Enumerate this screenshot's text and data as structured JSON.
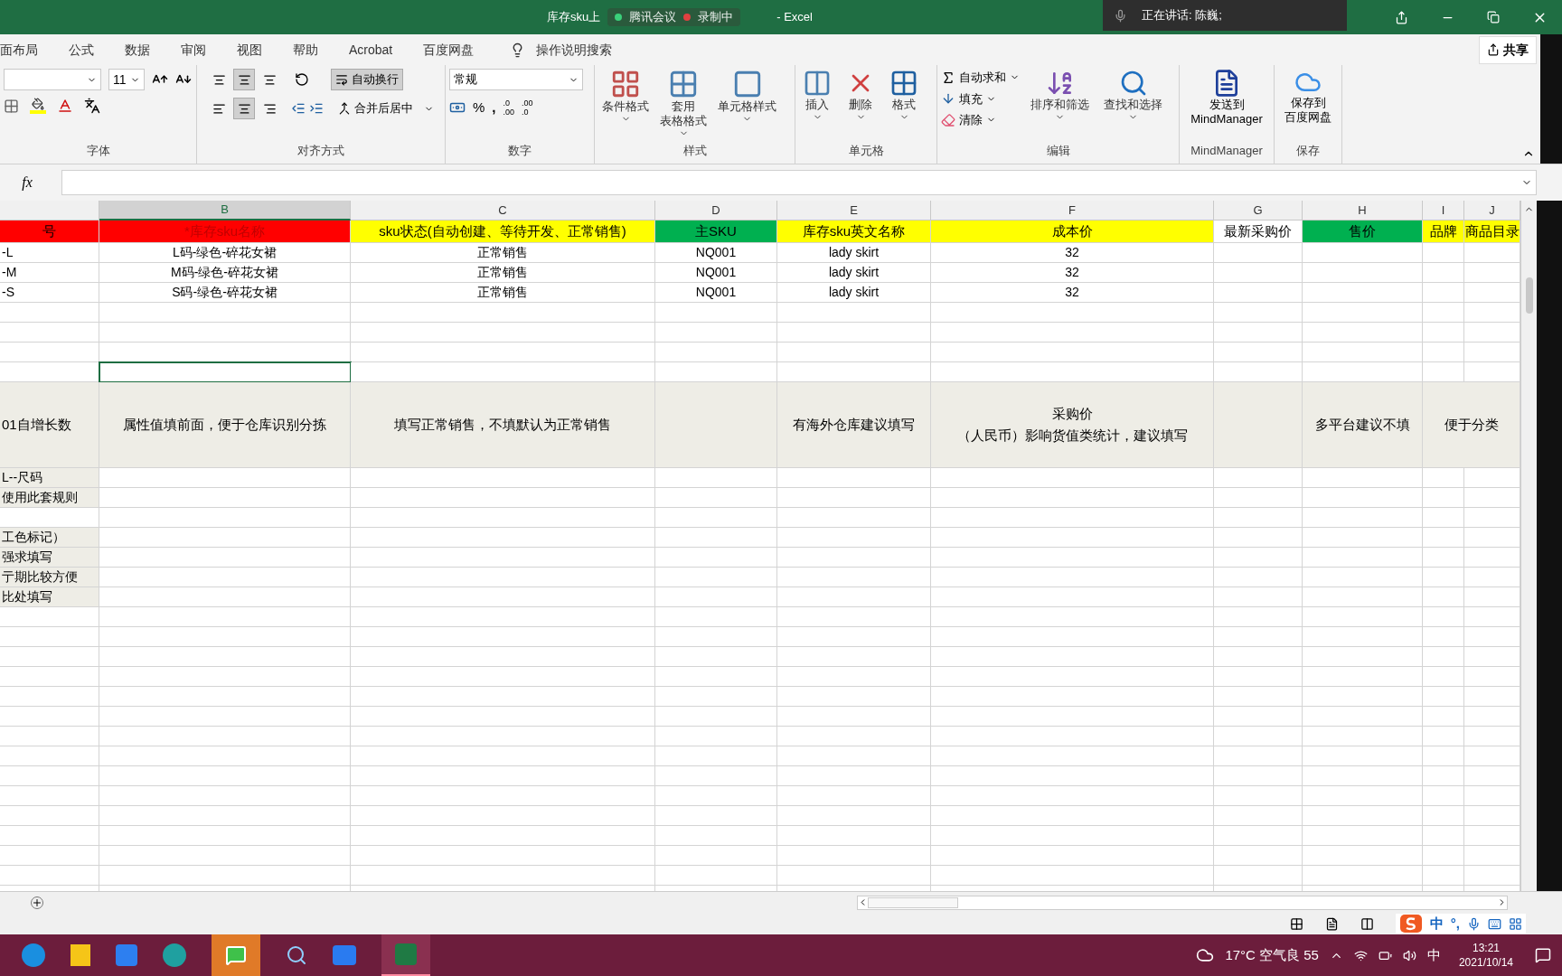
{
  "title_bar": {
    "title": "库存sku上",
    "suffix": "-  Excel",
    "meeting": {
      "app": "腾讯会议",
      "recording": "录制中"
    },
    "speaker": "正在讲话: 陈巍;"
  },
  "menu_tabs": [
    {
      "label": "面布局"
    },
    {
      "label": "公式"
    },
    {
      "label": "数据"
    },
    {
      "label": "审阅"
    },
    {
      "label": "视图"
    },
    {
      "label": "帮助"
    },
    {
      "label": "Acrobat"
    },
    {
      "label": "百度网盘"
    }
  ],
  "tell_me": "操作说明搜索",
  "share": "共享",
  "ribbon": {
    "font": {
      "size": "11",
      "group": "字体"
    },
    "alignment": {
      "vertical": [
        {
          "selected": false
        },
        {
          "selected": true
        },
        {
          "selected": false
        }
      ],
      "horizontal": [
        {
          "selected": false
        },
        {
          "selected": true
        },
        {
          "selected": false
        }
      ],
      "wrap": {
        "label": "自动换行",
        "on": true
      },
      "merge": "合并后居中",
      "group": "对齐方式"
    },
    "number": {
      "format": "常规",
      "percent": "%",
      "comma": ",",
      "decimal_increase": [
        ".0",
        ".00"
      ],
      "decimal_decrease": [
        ".00",
        ".0"
      ],
      "group": "数字"
    },
    "styles": {
      "buttons": [
        {
          "kind": "conditional",
          "lines": [
            "条件格式"
          ]
        },
        {
          "kind": "table",
          "lines": [
            "套用",
            "表格格式"
          ]
        },
        {
          "kind": "cell",
          "lines": [
            "单元格样式"
          ]
        }
      ],
      "group": "样式"
    },
    "cells": {
      "buttons": [
        {
          "kind": "insert",
          "label": "插入"
        },
        {
          "kind": "delete",
          "label": "删除"
        },
        {
          "kind": "format",
          "label": "格式"
        }
      ],
      "group": "单元格"
    },
    "editing": {
      "small": [
        {
          "kind": "sum",
          "label": "自动求和"
        },
        {
          "kind": "fill",
          "label": "填充"
        },
        {
          "kind": "clear",
          "label": "清除"
        }
      ],
      "big": [
        {
          "kind": "sort",
          "label": "排序和筛选"
        },
        {
          "kind": "find",
          "label": "查找和选择"
        }
      ],
      "group": "编辑"
    },
    "mindmanager": {
      "lines": [
        "发送到",
        "MindManager"
      ],
      "group": "MindManager"
    },
    "save": {
      "lines": [
        "保存到",
        "百度网盘"
      ],
      "group": "保存"
    }
  },
  "formula_bar": {
    "fx": "fx"
  },
  "columns": [
    {
      "selected": false
    },
    {
      "label": "B",
      "selected": true
    },
    {
      "label": "C",
      "selected": false
    },
    {
      "label": "D",
      "selected": false
    },
    {
      "label": "E",
      "selected": false
    },
    {
      "label": "F",
      "selected": false
    },
    {
      "label": "G",
      "selected": false
    },
    {
      "label": "H",
      "selected": false
    },
    {
      "label": "I",
      "selected": false
    },
    {
      "label": "J",
      "selected": false
    }
  ],
  "rows": [
    {
      "kind": "header",
      "cells": [
        {
          "text": "号",
          "color": "#ff0000"
        },
        {
          "text": "*库存sku名称",
          "color": "#ff0000"
        },
        {
          "text": "sku状态(自动创建、等待开发、正常销售)",
          "color": "#ffff00"
        },
        {
          "text": "主SKU",
          "color": "#00b050"
        },
        {
          "text": "库存sku英文名称",
          "color": "#ffff00"
        },
        {
          "text": "成本价",
          "color": "#ffff00"
        },
        {
          "text": "最新采购价",
          "color": "#ffffff"
        },
        {
          "text": "售价",
          "color": "#00b050"
        },
        {
          "text": "品牌",
          "color": "#ffff00"
        },
        {
          "text": "商品目录",
          "color": "#ffff00"
        }
      ]
    },
    {
      "kind": "data",
      "cells": [
        {
          "text": "-L"
        },
        {
          "text": "L码-绿色-碎花女裙"
        },
        {
          "text": "正常销售"
        },
        {
          "text": "NQ001"
        },
        {
          "text": "lady skirt"
        },
        {
          "text": "32"
        }
      ]
    },
    {
      "kind": "data",
      "cells": [
        {
          "text": "-M"
        },
        {
          "text": "M码-绿色-碎花女裙"
        },
        {
          "text": "正常销售"
        },
        {
          "text": "NQ001"
        },
        {
          "text": "lady skirt"
        },
        {
          "text": "32"
        }
      ]
    },
    {
      "kind": "data",
      "cells": [
        {
          "text": "-S"
        },
        {
          "text": "S码-绿色-碎花女裙"
        },
        {
          "text": "正常销售"
        },
        {
          "text": "NQ001"
        },
        {
          "text": "lady skirt"
        },
        {
          "text": "32"
        }
      ]
    },
    {
      "kind": "blank",
      "cells": []
    },
    {
      "kind": "blank",
      "cells": []
    },
    {
      "kind": "blank",
      "cells": []
    },
    {
      "kind": "blank",
      "cells": [
        {},
        {
          "selected": true
        }
      ]
    },
    {
      "kind": "note",
      "cells": [
        {
          "lines": [
            "01自增长数"
          ]
        },
        {
          "lines": [
            "属性值填前面，便于仓库识别分拣"
          ]
        },
        {
          "lines": [
            "填写正常销售，不填默认为正常销售"
          ]
        },
        {},
        {
          "lines": [
            "有海外仓库建议填写"
          ]
        },
        {
          "lines": [
            "采购价",
            "（人民币）影响货值类统计，建议填写"
          ]
        },
        {},
        {
          "lines": [
            "多平台建议不填"
          ]
        },
        {
          "lines": [
            "便于分类"
          ]
        }
      ]
    },
    {
      "kind": "side",
      "cells": [
        {
          "text": "L--尺码"
        }
      ]
    },
    {
      "kind": "side",
      "cells": [
        {
          "text": "使用此套规则"
        }
      ]
    },
    {
      "kind": "blank",
      "cells": []
    },
    {
      "kind": "side",
      "cells": [
        {
          "text": "工色标记）"
        }
      ]
    },
    {
      "kind": "side",
      "cells": [
        {
          "text": "强求填写"
        }
      ]
    },
    {
      "kind": "side",
      "cells": [
        {
          "text": "亍期比较方便"
        }
      ]
    },
    {
      "kind": "side",
      "cells": [
        {
          "text": "比处填写"
        }
      ]
    }
  ],
  "ime": {
    "mode": "中",
    "punct": "°,"
  },
  "taskbar": {
    "weather": "17°C 空气良 55",
    "input": "中",
    "time": "13:21",
    "date": "2021/10/14"
  }
}
